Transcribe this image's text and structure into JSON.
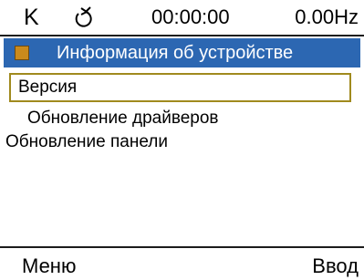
{
  "status_bar": {
    "mode": "K",
    "rotation_icon": "rotation-arrow-icon",
    "time": "00:00:00",
    "frequency": "0.00Hz"
  },
  "header": {
    "icon": "square-icon",
    "icon_color": "#c98a1c",
    "background_color": "#2c67b2",
    "title": "Информация об устройстве"
  },
  "menu": {
    "items": [
      {
        "label": "Версия",
        "selected": true
      },
      {
        "label": "Обновление драйверов",
        "selected": false
      },
      {
        "label": "Обновление панели",
        "selected": false
      }
    ],
    "selection_border_color": "#a08a1e"
  },
  "softkeys": {
    "left": "Меню",
    "right": "Ввод"
  }
}
